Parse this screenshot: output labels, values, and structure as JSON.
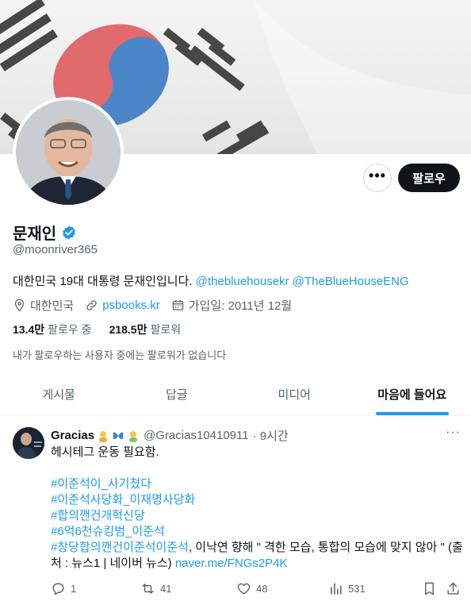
{
  "profile": {
    "name": "문재인",
    "handle": "@moonriver365",
    "bio_text": "대한민국 19대 대통령 문재인입니다.",
    "bio_link_1": "@thebluehousekr",
    "bio_link_2": "@TheBlueHouseENG",
    "location": "대한민국",
    "website": "psbooks.kr",
    "joined": "가입일: 2011년 12월",
    "following_count": "13.4만",
    "following_label": "팔로우 중",
    "followers_count": "218.5만",
    "followers_label": "팔로워",
    "no_followers_known": "내가 팔로우하는 사용자 중에는 팔로워가 없습니다"
  },
  "buttons": {
    "more": "•••",
    "follow": "팔로우"
  },
  "tabs": [
    {
      "label": "게시물",
      "active": false
    },
    {
      "label": "답글",
      "active": false
    },
    {
      "label": "미디어",
      "active": false
    },
    {
      "label": "마음에 들어요",
      "active": true
    }
  ],
  "tweet": {
    "author": "Gracias",
    "handle": "@Gracias10410911",
    "time": "· 9시간",
    "more": "···",
    "line1": "헤시테그 운동 필요함.",
    "tags": [
      "#이준석이_사기쳤다",
      "#이준석사당화_이재명사당화",
      "#합의깬건개혁신당",
      "#6억6천슈킹범_이준석"
    ],
    "last_tag": "#창당합의깬건이준석이준석",
    "last_text_1": ", 이낙연 향해  \" 격한 모습, 통합의 모습에 맞지 않아 \"  (출처 : 뉴스1 | 네이버 뉴스) ",
    "last_link": "naver.me/FNGs2P4K",
    "replies": "1",
    "retweets": "41",
    "likes": "48",
    "views": "531"
  },
  "colors": {
    "accent": "#1d9bf0",
    "text": "#0f1419",
    "muted": "#536471",
    "verified": "#1d9bf0"
  },
  "icons": [
    "verified-badge-icon",
    "location-icon",
    "link-icon",
    "calendar-icon",
    "reply-icon",
    "retweet-icon",
    "like-icon",
    "views-icon",
    "bookmark-icon",
    "share-icon"
  ]
}
